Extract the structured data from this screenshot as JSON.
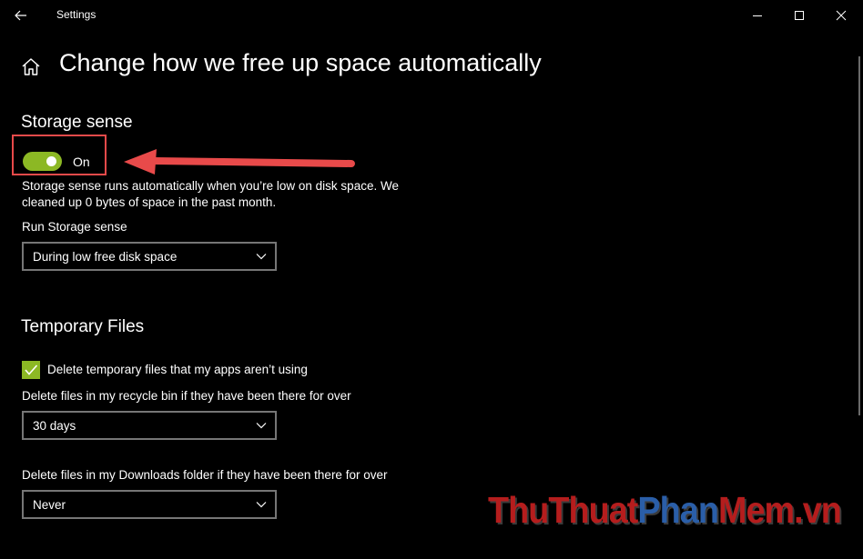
{
  "window": {
    "title": "Settings"
  },
  "header": {
    "page_title": "Change how we free up space automatically"
  },
  "storage_sense": {
    "heading": "Storage sense",
    "toggle_state": "On",
    "toggle_on": true,
    "description_line1": "Storage sense runs automatically when you’re low on disk space. We",
    "description_line2": "cleaned up 0 bytes of space in the past month.",
    "run_label": "Run Storage sense",
    "run_value": "During low free disk space"
  },
  "temporary_files": {
    "heading": "Temporary Files",
    "checkbox_label": "Delete temporary files that my apps aren’t using",
    "checkbox_checked": true,
    "recycle_bin_label": "Delete files in my recycle bin if they have been there for over",
    "recycle_bin_value": "30 days",
    "downloads_label": "Delete files in my Downloads folder if they have been there for over",
    "downloads_value": "Never"
  },
  "watermark": {
    "part1": "Thu",
    "part2": "Thuat",
    "part3": "Phan",
    "part4": "Mem",
    "part5": ".vn"
  },
  "icons": {
    "back": "back-arrow-icon",
    "home": "home-icon",
    "minimize": "minimize-icon",
    "maximize": "maximize-icon",
    "close": "close-icon",
    "chevron": "chevron-down-icon",
    "check": "checkmark-icon",
    "annotation": "red-arrow-icon"
  },
  "colors": {
    "accent": "#8cb824",
    "highlight": "#e84a4a",
    "background": "#000000",
    "watermark_red": "#b51d1d",
    "watermark_blue": "#2a5ea8"
  }
}
